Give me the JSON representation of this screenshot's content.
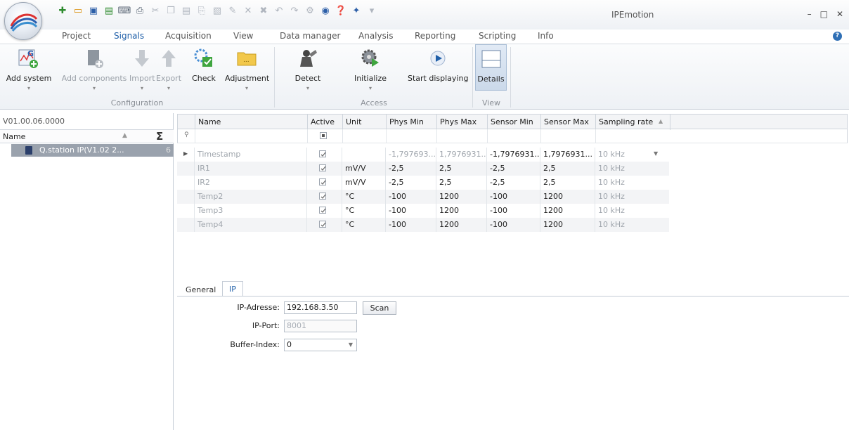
{
  "app": {
    "title": "IPEmotion"
  },
  "quick_access": {
    "items": [
      "new-icon",
      "open-icon",
      "save-icon",
      "save-as-icon",
      "keyboard-icon",
      "print-icon",
      "cut-icon",
      "copy-icon",
      "paste-icon",
      "paste-special-icon",
      "template-icon",
      "edit-icon",
      "delete-icon",
      "delete-all-icon",
      "undo-icon",
      "redo-icon",
      "settings-icon",
      "record-icon",
      "help-icon",
      "wizard-icon",
      "dropdown-icon"
    ]
  },
  "window_controls": {
    "minimize": "–",
    "maximize": "□",
    "close": "✕"
  },
  "ribbon_tabs": [
    {
      "label": "Project"
    },
    {
      "label": "Signals"
    },
    {
      "label": "Acquisition"
    },
    {
      "label": "View"
    },
    {
      "label": "Data manager"
    },
    {
      "label": "Analysis"
    },
    {
      "label": "Reporting"
    },
    {
      "label": "Scripting"
    },
    {
      "label": "Info"
    }
  ],
  "ribbon": {
    "configuration": {
      "add_system": "Add system",
      "add_components": "Add components",
      "import": "Import",
      "export": "Export",
      "check": "Check",
      "adjustment": "Adjustment",
      "group": "Configuration"
    },
    "access": {
      "detect": "Detect",
      "initialize": "Initialize",
      "start_displaying": "Start displaying",
      "group": "Access"
    },
    "view": {
      "details": "Details",
      "group": "View"
    }
  },
  "tree": {
    "version": "V01.00.06.0000",
    "header_name": "Name",
    "sigma": "Σ",
    "device_label": "Q.station IP(V1.02 2...",
    "device_count": "6"
  },
  "grid": {
    "columns": [
      "Name",
      "Active",
      "Unit",
      "Phys Min",
      "Phys Max",
      "Sensor Min",
      "Sensor Max",
      "Sampling rate"
    ],
    "rows": [
      {
        "name": "Timestamp",
        "active": true,
        "unit": "",
        "phys_min": "-1,797693...",
        "phys_max": "1,7976931...",
        "sensor_min": "-1,7976931...",
        "sensor_max": "1,7976931...",
        "rate": "10 kHz"
      },
      {
        "name": "IR1",
        "active": true,
        "unit": "mV/V",
        "phys_min": "-2,5",
        "phys_max": "2,5",
        "sensor_min": "-2,5",
        "sensor_max": "2,5",
        "rate": "10 kHz"
      },
      {
        "name": "IR2",
        "active": true,
        "unit": "mV/V",
        "phys_min": "-2,5",
        "phys_max": "2,5",
        "sensor_min": "-2,5",
        "sensor_max": "2,5",
        "rate": "10 kHz"
      },
      {
        "name": "Temp2",
        "active": true,
        "unit": "°C",
        "phys_min": "-100",
        "phys_max": "1200",
        "sensor_min": "-100",
        "sensor_max": "1200",
        "rate": "10 kHz"
      },
      {
        "name": "Temp3",
        "active": true,
        "unit": "°C",
        "phys_min": "-100",
        "phys_max": "1200",
        "sensor_min": "-100",
        "sensor_max": "1200",
        "rate": "10 kHz"
      },
      {
        "name": "Temp4",
        "active": true,
        "unit": "°C",
        "phys_min": "-100",
        "phys_max": "1200",
        "sensor_min": "-100",
        "sensor_max": "1200",
        "rate": "10 kHz"
      }
    ]
  },
  "prop_tabs": [
    {
      "label": "General"
    },
    {
      "label": "IP"
    }
  ],
  "ip_form": {
    "ip_label": "IP-Adresse:",
    "ip_value": "192.168.3.50",
    "scan": "Scan",
    "port_label": "IP-Port:",
    "port_value": "8001",
    "buffer_label": "Buffer-Index:",
    "buffer_value": "0"
  }
}
